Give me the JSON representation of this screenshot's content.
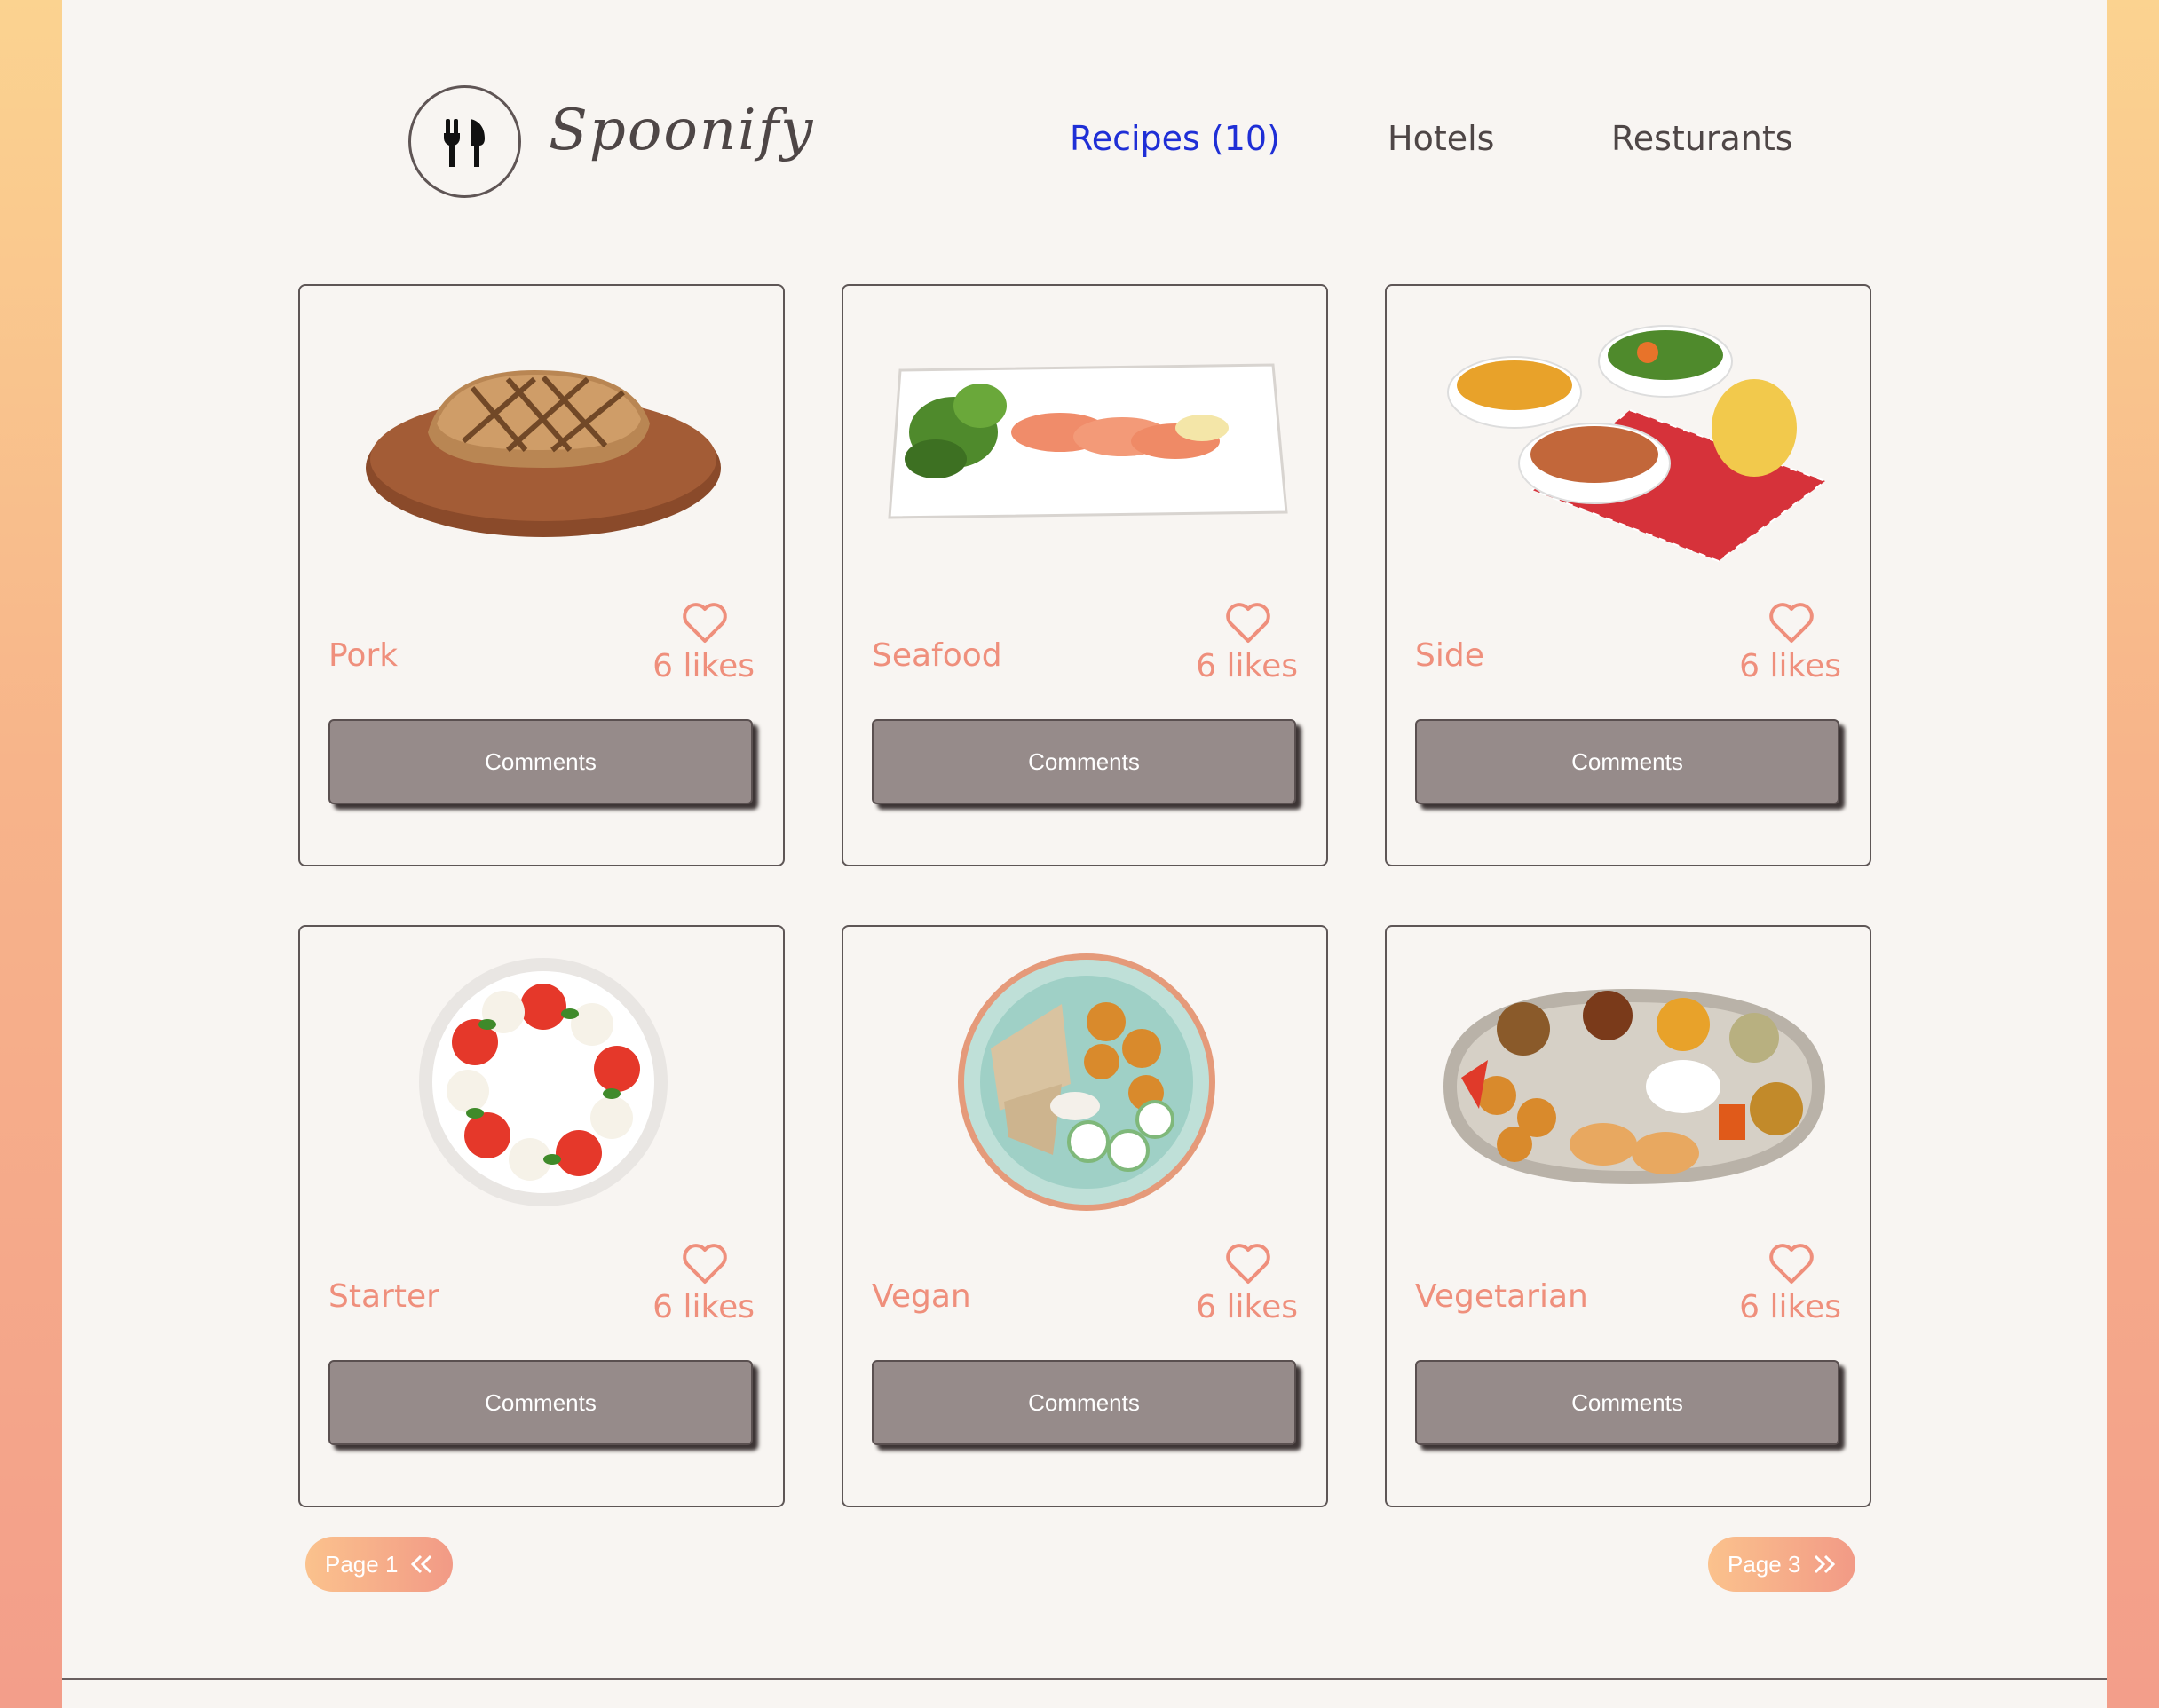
{
  "brand": {
    "name": "Spoonify",
    "logo_icon": "fork-knife-icon"
  },
  "nav": [
    {
      "label": "Recipes (10)",
      "active": true
    },
    {
      "label": "Hotels",
      "active": false
    },
    {
      "label": "Resturants",
      "active": false
    }
  ],
  "cards": [
    {
      "title": "Pork",
      "likes": "6 likes",
      "button": "Comments",
      "image": "steak-on-board"
    },
    {
      "title": "Seafood",
      "likes": "6 likes",
      "button": "Comments",
      "image": "salmon-plate"
    },
    {
      "title": "Side",
      "likes": "6 likes",
      "button": "Comments",
      "image": "side-bowls"
    },
    {
      "title": "Starter",
      "likes": "6 likes",
      "button": "Comments",
      "image": "caprese-plate"
    },
    {
      "title": "Vegan",
      "likes": "6 likes",
      "button": "Comments",
      "image": "vegan-bowl"
    },
    {
      "title": "Vegetarian",
      "likes": "6 likes",
      "button": "Comments",
      "image": "thali-platter"
    }
  ],
  "pagination": {
    "prev_label": "Page 1",
    "next_label": "Page 3",
    "prev_icon": "double-chevron-left-icon",
    "next_icon": "double-chevron-right-icon"
  },
  "colors": {
    "accent": "#ef8f7c",
    "nav_active": "#1f2fd6",
    "button": "#968b8a",
    "page_bg": "#f8f5f2"
  }
}
